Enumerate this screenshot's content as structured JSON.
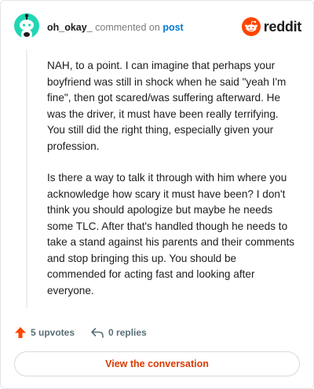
{
  "header": {
    "username": "oh_okay_",
    "action_text": "commented on",
    "target_text": "post",
    "brand": "reddit"
  },
  "comment": {
    "paragraphs": [
      "NAH, to a point. I can imagine that perhaps your boyfriend was still in shock when he said \"yeah I'm fine\", then got scared/was suffering afterward. He was the driver, it must have been really terrifying. You still did the right thing, especially given your profession.",
      "Is there a way to talk it through with him where you acknowledge how scary it must have been? I don't think you should apologize but maybe he needs some TLC. After that's handled though he needs to take a stand against his parents and their comments and stop bringing this up. You should be commended for acting fast and looking after everyone."
    ]
  },
  "footer": {
    "upvotes_label": "5 upvotes",
    "replies_label": "0 replies"
  },
  "cta": {
    "label": "View the conversation"
  },
  "colors": {
    "accent": "#ff4500",
    "link": "#0079d3",
    "avatar": "#21d6b4",
    "cta_text": "#d93a00"
  },
  "icons": {
    "avatar": "snoo-avatar-icon",
    "logo": "reddit-logo-icon",
    "upvote": "upvote-arrow-icon",
    "reply": "reply-arrow-icon"
  }
}
